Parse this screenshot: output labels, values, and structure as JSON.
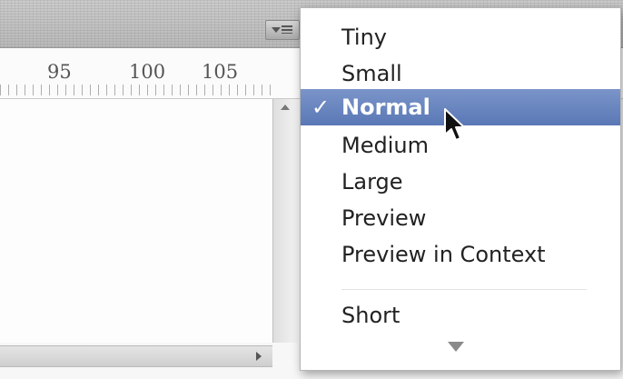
{
  "ruler": {
    "labels": [
      "95",
      "100",
      "105"
    ]
  },
  "panel_menu": {
    "icon": "panel-menu-icon"
  },
  "menu": {
    "items": [
      {
        "label": "Tiny",
        "selected": false
      },
      {
        "label": "Small",
        "selected": false
      },
      {
        "label": "Normal",
        "selected": true
      },
      {
        "label": "Medium",
        "selected": false
      },
      {
        "label": "Large",
        "selected": false
      },
      {
        "label": "Preview",
        "selected": false
      },
      {
        "label": "Preview in Context",
        "selected": false
      },
      {
        "label": "Short",
        "selected": false
      }
    ],
    "check_mark": "✓",
    "more_indicator": "scroll-down-arrow-icon"
  },
  "colors": {
    "selection": "#5a78b6",
    "menu_bg": "#ffffff",
    "toolbar": "#bdbdbd"
  }
}
